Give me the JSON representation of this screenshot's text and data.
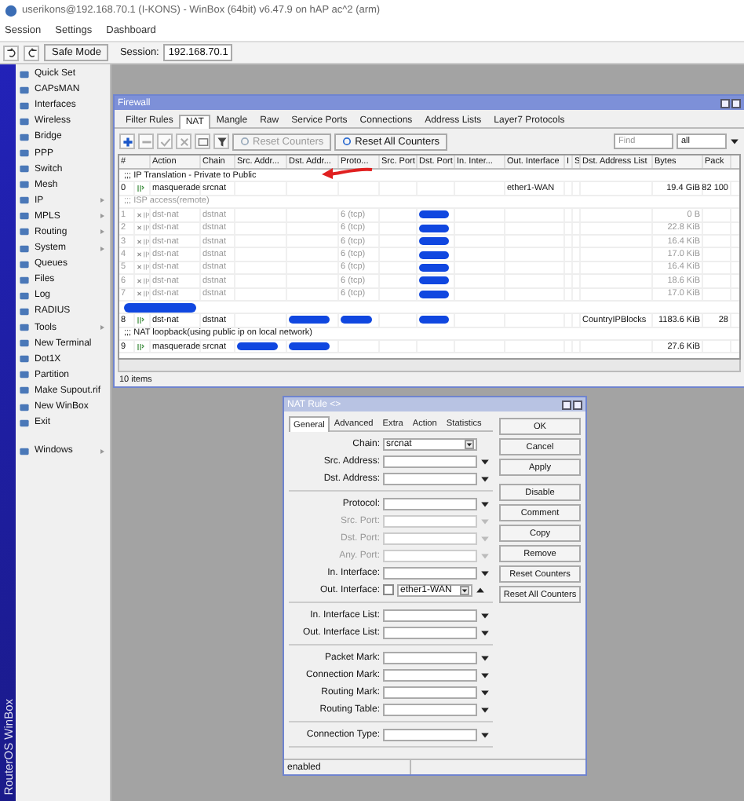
{
  "app_title": "userikons@192.168.70.1 (I-KONS) - WinBox (64bit) v6.47.9 on hAP ac^2 (arm)",
  "menu": [
    "Session",
    "Settings",
    "Dashboard"
  ],
  "toolbar": {
    "safe_mode": "Safe Mode",
    "session_label": "Session:",
    "session_value": "192.168.70.1"
  },
  "sidebar": {
    "items": [
      {
        "label": "Quick Set",
        "submenu": false
      },
      {
        "label": "CAPsMAN",
        "submenu": false
      },
      {
        "label": "Interfaces",
        "submenu": false
      },
      {
        "label": "Wireless",
        "submenu": false
      },
      {
        "label": "Bridge",
        "submenu": false
      },
      {
        "label": "PPP",
        "submenu": false
      },
      {
        "label": "Switch",
        "submenu": false
      },
      {
        "label": "Mesh",
        "submenu": false
      },
      {
        "label": "IP",
        "submenu": true
      },
      {
        "label": "MPLS",
        "submenu": true
      },
      {
        "label": "Routing",
        "submenu": true
      },
      {
        "label": "System",
        "submenu": true
      },
      {
        "label": "Queues",
        "submenu": false
      },
      {
        "label": "Files",
        "submenu": false
      },
      {
        "label": "Log",
        "submenu": false
      },
      {
        "label": "RADIUS",
        "submenu": false
      },
      {
        "label": "Tools",
        "submenu": true
      },
      {
        "label": "New Terminal",
        "submenu": false
      },
      {
        "label": "Dot1X",
        "submenu": false
      },
      {
        "label": "Partition",
        "submenu": false
      },
      {
        "label": "Make Supout.rif",
        "submenu": false
      },
      {
        "label": "New WinBox",
        "submenu": false
      },
      {
        "label": "Exit",
        "submenu": false
      }
    ],
    "windows": {
      "label": "Windows",
      "submenu": true
    },
    "brand": "RouterOS WinBox"
  },
  "firewall": {
    "title": "Firewall",
    "tabs": [
      {
        "label": "Filter Rules",
        "selected": false
      },
      {
        "label": "NAT",
        "selected": true
      },
      {
        "label": "Mangle",
        "selected": false
      },
      {
        "label": "Raw",
        "selected": false
      },
      {
        "label": "Service Ports",
        "selected": false
      },
      {
        "label": "Connections",
        "selected": false
      },
      {
        "label": "Address Lists",
        "selected": false
      },
      {
        "label": "Layer7 Protocols",
        "selected": false
      }
    ],
    "buttons": [
      {
        "label": "Reset Counters",
        "disabled": true
      },
      {
        "label": "Reset All Counters",
        "disabled": false
      }
    ],
    "find": {
      "placeholder": "Find"
    },
    "filter": "all",
    "columns": [
      "#",
      "Action",
      "Chain",
      "Src. Addr...",
      "Dst. Addr...",
      "Proto...",
      "Src. Port",
      "Dst. Port",
      "In. Inter...",
      "Out. Interface",
      "I",
      "S",
      "Dst. Address List",
      "Bytes",
      "Pack"
    ],
    "rows": [
      {
        "kind": "comment",
        "text": ";;; IP Translation - Private to Public",
        "disabled": false
      },
      {
        "kind": "rule",
        "number": "0",
        "action": "masquerade",
        "chain": "srcnat",
        "out_interface": "ether1-WAN",
        "bytes": "19.4 GiB",
        "packets": "82 100",
        "disabled": false
      },
      {
        "kind": "comment",
        "text": ";;; ISP access(remote)",
        "disabled": true
      },
      {
        "kind": "rule",
        "number": "1",
        "action": "dst-nat",
        "chain": "dstnat",
        "protocol": "6 (tcp)",
        "bytes": "0 B",
        "disabled": true,
        "masked": {
          "dst_port": true
        }
      },
      {
        "kind": "rule",
        "number": "2",
        "action": "dst-nat",
        "chain": "dstnat",
        "protocol": "6 (tcp)",
        "bytes": "22.8 KiB",
        "disabled": true,
        "masked": {
          "dst_port": true
        }
      },
      {
        "kind": "rule",
        "number": "3",
        "action": "dst-nat",
        "chain": "dstnat",
        "protocol": "6 (tcp)",
        "bytes": "16.4 KiB",
        "disabled": true,
        "masked": {
          "dst_port": true
        }
      },
      {
        "kind": "rule",
        "number": "4",
        "action": "dst-nat",
        "chain": "dstnat",
        "protocol": "6 (tcp)",
        "bytes": "17.0 KiB",
        "disabled": true,
        "masked": {
          "dst_port": true
        }
      },
      {
        "kind": "rule",
        "number": "5",
        "action": "dst-nat",
        "chain": "dstnat",
        "protocol": "6 (tcp)",
        "bytes": "16.4 KiB",
        "disabled": true,
        "masked": {
          "dst_port": true
        }
      },
      {
        "kind": "rule",
        "number": "6",
        "action": "dst-nat",
        "chain": "dstnat",
        "protocol": "6 (tcp)",
        "bytes": "18.6 KiB",
        "disabled": true,
        "masked": {
          "dst_port": true
        }
      },
      {
        "kind": "rule",
        "number": "7",
        "action": "dst-nat",
        "chain": "dstnat",
        "protocol": "6 (tcp)",
        "bytes": "17.0 KiB",
        "disabled": true,
        "masked": {
          "dst_port": true
        }
      },
      {
        "kind": "redacted"
      },
      {
        "kind": "rule",
        "number": "8",
        "action": "dst-nat",
        "chain": "dstnat",
        "dst_address_list": "CountryIPBlocks",
        "bytes": "1183.6 KiB",
        "packets": "28",
        "disabled": false,
        "masked": {
          "dst_address": true,
          "protocol": true,
          "dst_port": true
        }
      },
      {
        "kind": "comment",
        "text": ";;; NAT loopback(using public ip on local network)",
        "disabled": false
      },
      {
        "kind": "rule",
        "number": "9",
        "action": "masquerade",
        "chain": "srcnat",
        "bytes": "27.6 KiB",
        "disabled": false,
        "masked": {
          "src_address": true,
          "dst_address": true
        }
      }
    ],
    "status": "10 items"
  },
  "nat_rule": {
    "title": "NAT Rule <>",
    "tabs": [
      {
        "label": "General",
        "selected": true
      },
      {
        "label": "Advanced",
        "selected": false
      },
      {
        "label": "Extra",
        "selected": false
      },
      {
        "label": "Action",
        "selected": false
      },
      {
        "label": "Statistics",
        "selected": false
      }
    ],
    "groups": [
      [
        {
          "label": "Chain:",
          "kind": "select",
          "value": "srcnat",
          "disabled": false
        },
        {
          "label": "Src. Address:",
          "kind": "combo",
          "disabled": false
        },
        {
          "label": "Dst. Address:",
          "kind": "combo",
          "disabled": false
        }
      ],
      [
        {
          "label": "Protocol:",
          "kind": "combo",
          "disabled": false
        },
        {
          "label": "Src. Port:",
          "kind": "combo",
          "disabled": true
        },
        {
          "label": "Dst. Port:",
          "kind": "combo",
          "disabled": true
        },
        {
          "label": "Any. Port:",
          "kind": "combo",
          "disabled": true
        },
        {
          "label": "In. Interface:",
          "kind": "combo",
          "disabled": false
        },
        {
          "label": "Out. Interface:",
          "kind": "interface",
          "value": "ether1-WAN",
          "checked": false,
          "disabled": false
        }
      ],
      [
        {
          "label": "In. Interface List:",
          "kind": "combo",
          "disabled": false
        },
        {
          "label": "Out. Interface List:",
          "kind": "combo",
          "disabled": false
        }
      ],
      [
        {
          "label": "Packet Mark:",
          "kind": "combo",
          "disabled": false
        },
        {
          "label": "Connection Mark:",
          "kind": "combo",
          "disabled": false
        },
        {
          "label": "Routing Mark:",
          "kind": "combo",
          "disabled": false
        },
        {
          "label": "Routing Table:",
          "kind": "combo",
          "disabled": false
        }
      ],
      [
        {
          "label": "Connection Type:",
          "kind": "combo",
          "disabled": false
        }
      ]
    ],
    "buttons": [
      [
        "OK",
        "Cancel",
        "Apply"
      ],
      [
        "Disable",
        "Comment",
        "Copy",
        "Remove",
        "Reset Counters",
        "Reset All Counters"
      ]
    ],
    "status": "enabled"
  }
}
